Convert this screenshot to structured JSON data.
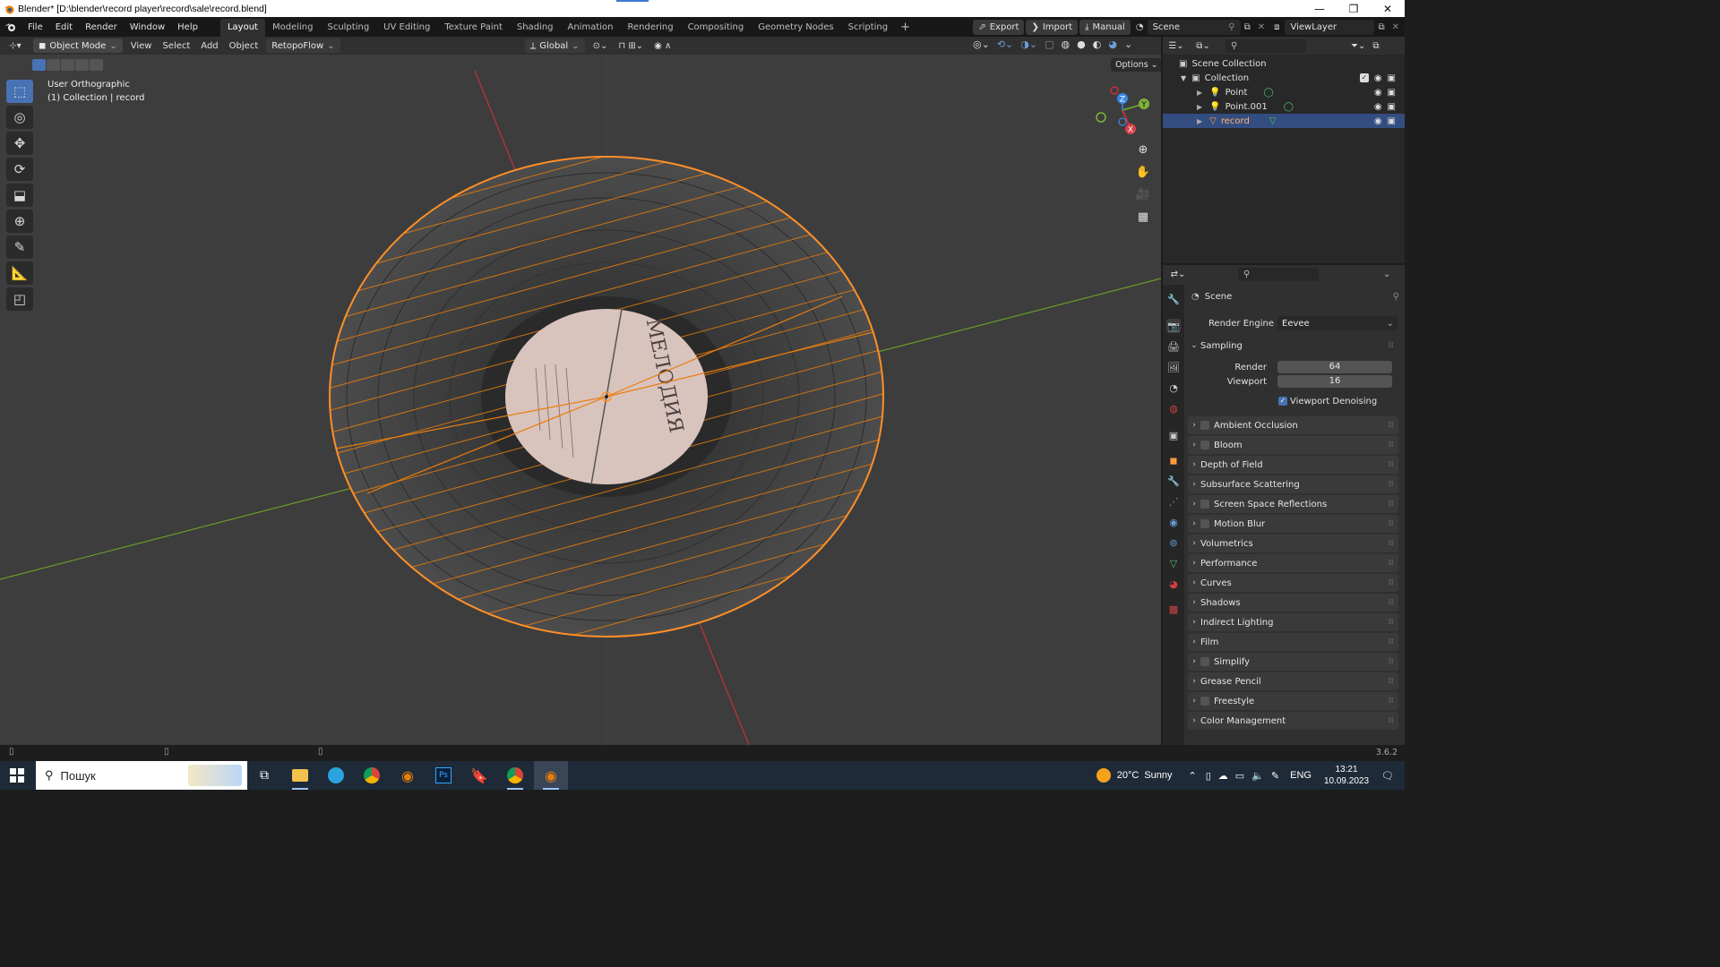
{
  "window": {
    "title": "Blender* [D:\\blender\\record player\\record\\sale\\record.blend]",
    "controls": [
      "minimize-icon",
      "restore-icon",
      "close-icon"
    ]
  },
  "menubar": {
    "menus": [
      "File",
      "Edit",
      "Render",
      "Window",
      "Help"
    ],
    "workspaces": [
      "Layout",
      "Modeling",
      "Sculpting",
      "UV Editing",
      "Texture Paint",
      "Shading",
      "Animation",
      "Rendering",
      "Compositing",
      "Geometry Nodes",
      "Scripting"
    ],
    "active_workspace": "Layout",
    "add_workspace": "+",
    "export_label": "Export",
    "import_label": "Import",
    "manual_label": "Manual",
    "scene_name": "Scene",
    "view_layer": "ViewLayer"
  },
  "viewport_header": {
    "mode": "Object Mode",
    "menus": [
      "View",
      "Select",
      "Add",
      "Object"
    ],
    "addon": "RetopoFlow",
    "transform_orientation": "Global",
    "options": "Options"
  },
  "viewport": {
    "view_name": "User Orthographic",
    "collection_info": "(1) Collection | record",
    "label_text": "МЕЛОДИЯ",
    "gizmo_axes": [
      "X",
      "Y",
      "Z"
    ],
    "colors": {
      "background": "#3d3d3d",
      "selection": "#ff8f27",
      "x_axis": "#c4323a",
      "y_axis": "#6a9b2a",
      "label": "#d9c3bd"
    }
  },
  "outliner": {
    "root": "Scene Collection",
    "collection": "Collection",
    "items": [
      {
        "name": "Point",
        "icon": "light-icon",
        "selected": false
      },
      {
        "name": "Point.001",
        "icon": "light-icon",
        "selected": false
      },
      {
        "name": "record",
        "icon": "mesh-icon",
        "selected": true
      }
    ]
  },
  "properties": {
    "context": "Scene",
    "render_engine_label": "Render Engine",
    "render_engine": "Eevee",
    "sampling": {
      "title": "Sampling",
      "render_label": "Render",
      "render_value": "64",
      "viewport_label": "Viewport",
      "viewport_value": "16",
      "denoise_label": "Viewport Denoising",
      "denoise_checked": true
    },
    "panels": [
      {
        "label": "Ambient Occlusion",
        "checkbox": true
      },
      {
        "label": "Bloom",
        "checkbox": true
      },
      {
        "label": "Depth of Field",
        "checkbox": false
      },
      {
        "label": "Subsurface Scattering",
        "checkbox": false
      },
      {
        "label": "Screen Space Reflections",
        "checkbox": true
      },
      {
        "label": "Motion Blur",
        "checkbox": true
      },
      {
        "label": "Volumetrics",
        "checkbox": false
      },
      {
        "label": "Performance",
        "checkbox": false
      },
      {
        "label": "Curves",
        "checkbox": false
      },
      {
        "label": "Shadows",
        "checkbox": false
      },
      {
        "label": "Indirect Lighting",
        "checkbox": false
      },
      {
        "label": "Film",
        "checkbox": false
      },
      {
        "label": "Simplify",
        "checkbox": true
      },
      {
        "label": "Grease Pencil",
        "checkbox": false
      },
      {
        "label": "Freestyle",
        "checkbox": true
      },
      {
        "label": "Color Management",
        "checkbox": false
      }
    ]
  },
  "statusbar": {
    "version": "3.6.2"
  },
  "taskbar": {
    "search_placeholder": "Пошук",
    "weather_temp": "20°C",
    "weather_text": "Sunny",
    "language": "ENG",
    "time": "13:21",
    "date": "10.09.2023"
  }
}
